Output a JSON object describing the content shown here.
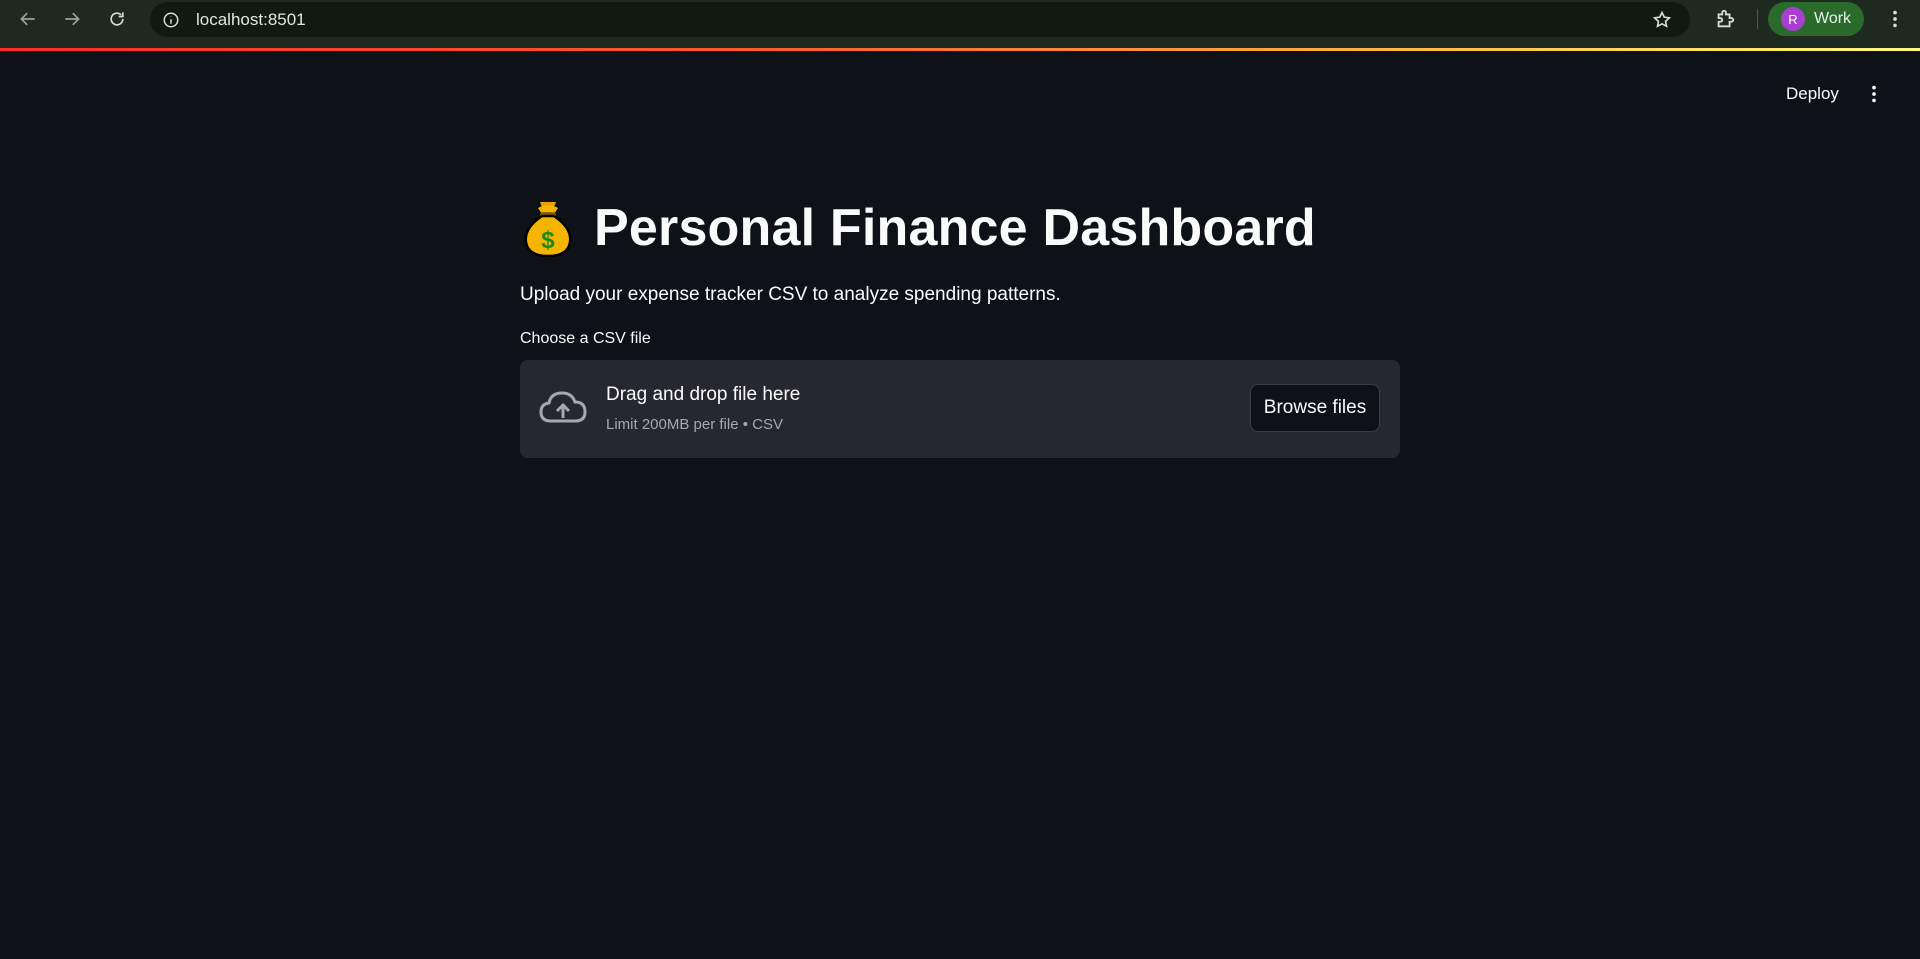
{
  "browser": {
    "url": "localhost:8501",
    "profile_initial": "R",
    "profile_name": "Work"
  },
  "app_header": {
    "deploy_label": "Deploy"
  },
  "main": {
    "title": "Personal Finance Dashboard",
    "title_icon": "money-bag-icon",
    "subtitle": "Upload your expense tracker CSV to analyze spending patterns.",
    "uploader": {
      "label": "Choose a CSV file",
      "drop_text": "Drag and drop file here",
      "limit_text": "Limit 200MB per file • CSV",
      "browse_label": "Browse files"
    }
  },
  "colors": {
    "background": "#0e1117",
    "dropzone": "#262730",
    "text": "#fafafa",
    "muted": "#a3a8b8",
    "profile_chip": "#2a6b2c",
    "avatar": "#a83fcf"
  }
}
